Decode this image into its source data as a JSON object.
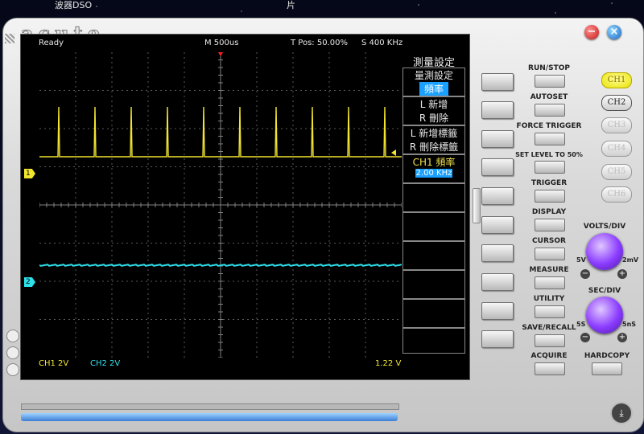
{
  "desktop": {
    "label_left": "波器DSO",
    "label_right": "片"
  },
  "window": {
    "minimize": "−",
    "close": "×"
  },
  "logo": "acute",
  "status": {
    "state": "Ready",
    "timebase": "M 500us",
    "tpos": "T Pos: 50.00%",
    "sample": "S 400 KHz"
  },
  "markers": {
    "ch1": "1",
    "ch2": "2"
  },
  "menu": {
    "title": "測量設定",
    "item1": "量測設定",
    "item1_value": "頻率",
    "add": "L 新增",
    "remove": "R 刪除",
    "add_label": "L 新增標籤",
    "remove_label": "R 刪除標籤",
    "measure_name": "CH1 頻率",
    "measure_value": "2.00 KHz"
  },
  "bottom": {
    "ch1": "CH1  2V",
    "ch2": "CH2  2V",
    "trigger_level": "1.22 V"
  },
  "buttons": {
    "run_stop": "RUN/STOP",
    "autoset": "AUTOSET",
    "force_trigger": "FORCE TRIGGER",
    "set_level": "SET LEVEL TO 50%",
    "trigger": "TRIGGER",
    "display": "DISPLAY",
    "cursor": "CURSOR",
    "measure": "MEASURE",
    "utility": "UTILITY",
    "save_recall": "SAVE/RECALL",
    "acquire": "ACQUIRE",
    "hardcopy": "HARDCOPY"
  },
  "channels": [
    "CH1",
    "CH2",
    "CH3",
    "CH4",
    "CH5",
    "CH6"
  ],
  "knobs": {
    "volts_title": "VOLTS/DIV",
    "volts_min": "5V",
    "volts_max": "2mV",
    "sec_title": "SEC/DIV",
    "sec_min": "5S",
    "sec_max": "5nS",
    "minus": "−",
    "plus": "+"
  },
  "colors": {
    "ch1": "#f2e530",
    "ch2": "#2ee0ea",
    "highlight": "#1aa0ff",
    "trigger_marker": "#ff2020"
  }
}
